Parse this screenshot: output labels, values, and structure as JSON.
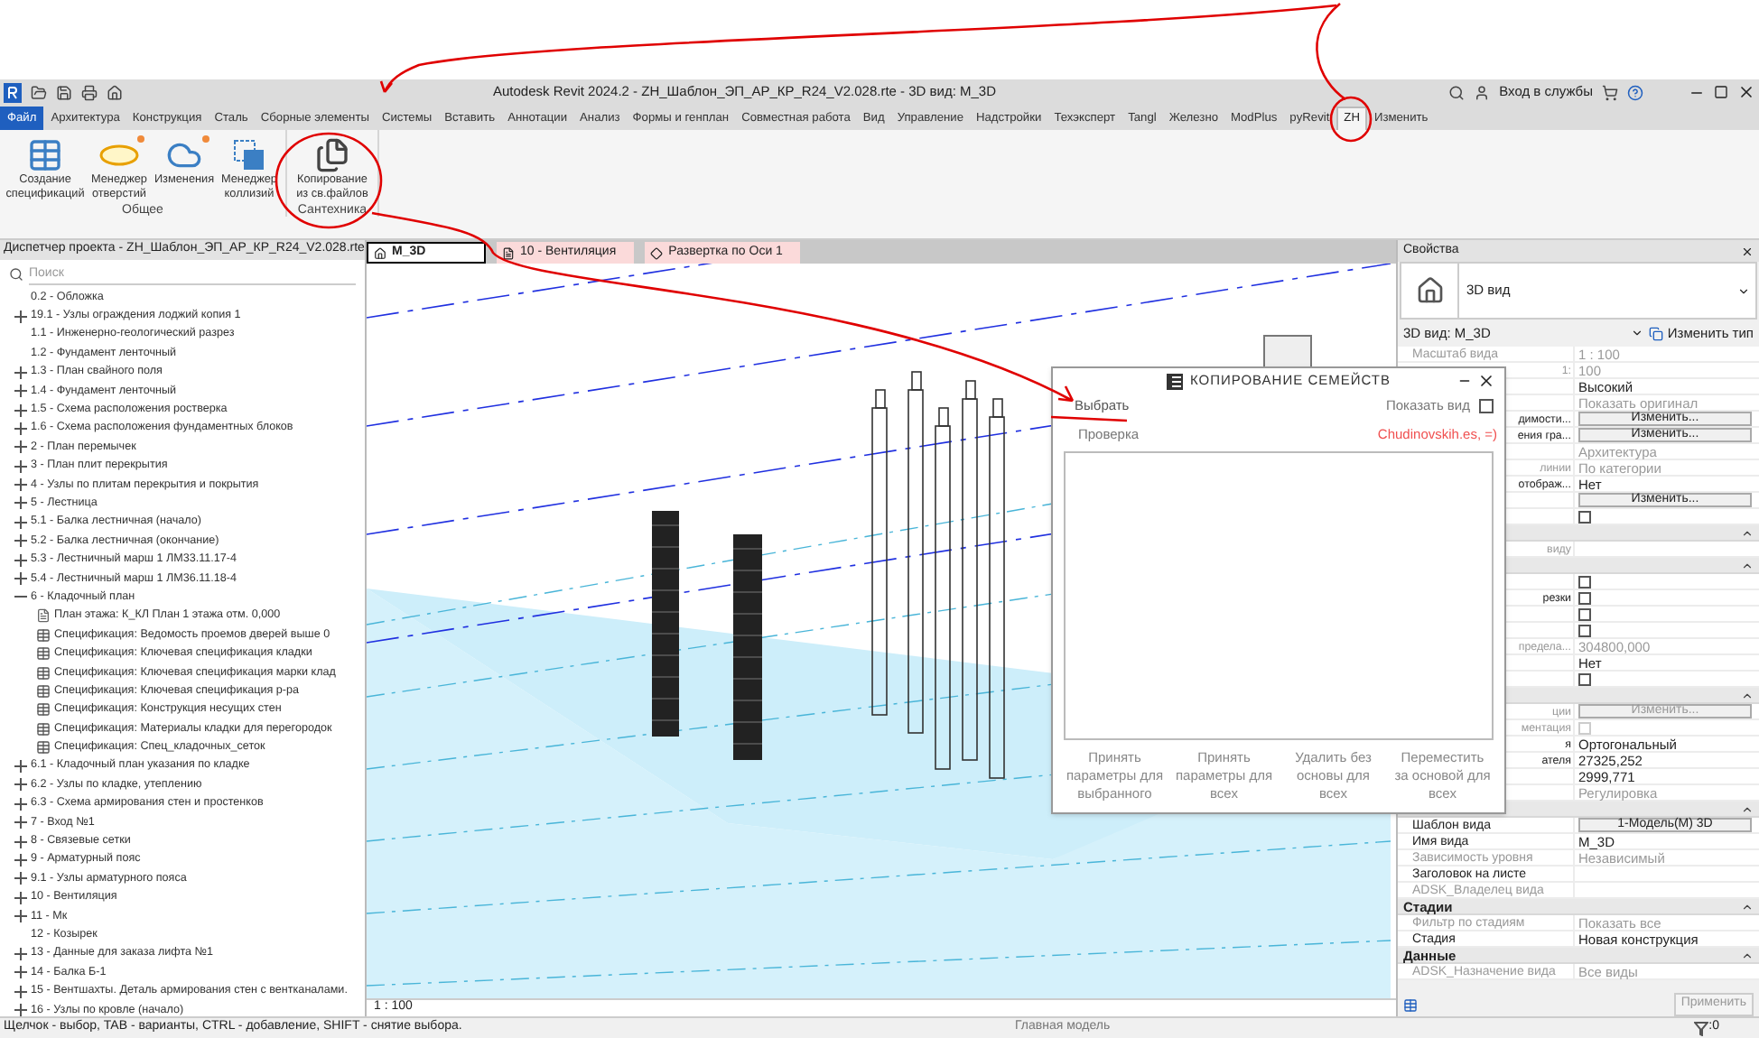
{
  "window": {
    "title": "Autodesk Revit 2024.2 - ZH_Шаблон_ЭП_АР_КР_R24_V2.028.rte - 3D вид: M_3D",
    "sign_in": "Вход в службы"
  },
  "menu_tabs": [
    {
      "label": "Файл",
      "kind": "file",
      "selected": false
    },
    {
      "label": "Архитектура",
      "kind": "tab",
      "selected": false
    },
    {
      "label": "Конструкция",
      "kind": "tab",
      "selected": false
    },
    {
      "label": "Сталь",
      "kind": "tab",
      "selected": false
    },
    {
      "label": "Сборные элементы",
      "kind": "tab",
      "selected": false
    },
    {
      "label": "Системы",
      "kind": "tab",
      "selected": false
    },
    {
      "label": "Вставить",
      "kind": "tab",
      "selected": false
    },
    {
      "label": "Аннотации",
      "kind": "tab",
      "selected": false
    },
    {
      "label": "Анализ",
      "kind": "tab",
      "selected": false
    },
    {
      "label": "Формы и генплан",
      "kind": "tab",
      "selected": false
    },
    {
      "label": "Совместная работа",
      "kind": "tab",
      "selected": false
    },
    {
      "label": "Вид",
      "kind": "tab",
      "selected": false
    },
    {
      "label": "Управление",
      "kind": "tab",
      "selected": false
    },
    {
      "label": "Надстройки",
      "kind": "tab",
      "selected": false
    },
    {
      "label": "Техэксперт",
      "kind": "tab",
      "selected": false
    },
    {
      "label": "Tangl",
      "kind": "tab",
      "selected": false
    },
    {
      "label": "Железно",
      "kind": "tab",
      "selected": false
    },
    {
      "label": "ModPlus",
      "kind": "tab",
      "selected": false
    },
    {
      "label": "pyRevit",
      "kind": "tab",
      "selected": false
    },
    {
      "label": "ZH",
      "kind": "tab",
      "selected": true
    },
    {
      "label": "Изменить",
      "kind": "tab",
      "selected": false
    }
  ],
  "ribbon_groups": [
    {
      "title": "Общее",
      "buttons": [
        {
          "label": "Создание спецификаций",
          "kind": "schedule",
          "new": false
        },
        {
          "label": "Менеджер отверстий",
          "kind": "opening",
          "new": true
        },
        {
          "label": "Изменения",
          "kind": "cloud",
          "new": true
        },
        {
          "label": "Менеджер коллизий",
          "kind": "collision",
          "new": false
        }
      ]
    },
    {
      "title": "Сантехника",
      "buttons": [
        {
          "label": "Копирование из св.файлов",
          "kind": "copy",
          "new": false
        }
      ]
    }
  ],
  "project_browser": {
    "title": "Диспетчер проекта - ZH_Шаблон_ЭП_АР_КР_R24_V2.028.rte",
    "search": {
      "placeholder": "Поиск"
    },
    "items": [
      {
        "label": "0.2 - Обложка"
      },
      {
        "label": "19.1 - Узлы ограждения лоджий копия 1",
        "expanded": false
      },
      {
        "label": "1.1 - Инженерно-геологический разрез"
      },
      {
        "label": "1.2 - Фундамент ленточный"
      },
      {
        "label": "1.3 - План свайного поля",
        "expanded": false
      },
      {
        "label": "1.4 - Фундамент ленточный",
        "expanded": false
      },
      {
        "label": "1.5 - Схема расположения ростверка",
        "expanded": false
      },
      {
        "label": "1.6 - Схема расположения фундаментных блоков",
        "expanded": false
      },
      {
        "label": "2 - План перемычек",
        "expanded": false
      },
      {
        "label": "3 - План плит перекрытия",
        "expanded": false
      },
      {
        "label": "4 - Узлы по плитам перекрытия и покрытия",
        "expanded": false
      },
      {
        "label": "5 - Лестница",
        "expanded": false
      },
      {
        "label": "5.1 - Балка лестничная (начало)",
        "expanded": false
      },
      {
        "label": "5.2 - Балка лестничная (окончание)",
        "expanded": false
      },
      {
        "label": "5.3 - Лестничный марш 1 ЛМ33.11.17-4",
        "expanded": false
      },
      {
        "label": "5.4 - Лестничный марш 1 ЛМ36.11.18-4",
        "expanded": false
      },
      {
        "label": "6 - Кладочный план",
        "expanded": true,
        "children": [
          {
            "label": "План этажа: К_КЛ План 1 этажа отм. 0,000",
            "kind": "plan"
          },
          {
            "label": "Спецификация: Ведомость проемов дверей выше 0",
            "kind": "schedule"
          },
          {
            "label": "Спецификация: Ключевая спецификация кладки",
            "kind": "schedule"
          },
          {
            "label": "Спецификация: Ключевая спецификация марки клад",
            "kind": "schedule"
          },
          {
            "label": "Спецификация: Ключевая спецификация р-ра",
            "kind": "schedule"
          },
          {
            "label": "Спецификация: Конструкция несущих стен",
            "kind": "schedule"
          },
          {
            "label": "Спецификация: Материалы кладки для перегородок",
            "kind": "schedule"
          },
          {
            "label": "Спецификация: Спец_кладочных_сеток",
            "kind": "schedule"
          }
        ]
      },
      {
        "label": "6.1 - Кладочный план указания по кладке",
        "expanded": false
      },
      {
        "label": "6.2 - Узлы по кладке, утеплению",
        "expanded": false
      },
      {
        "label": "6.3 - Схема армирования стен и простенков",
        "expanded": false
      },
      {
        "label": "7 - Вход №1",
        "expanded": false
      },
      {
        "label": "8 - Связевые сетки",
        "expanded": false
      },
      {
        "label": "9 - Арматурный пояс",
        "expanded": false
      },
      {
        "label": "9.1 - Узлы арматурного пояса",
        "expanded": false
      },
      {
        "label": "10 - Вентиляция",
        "expanded": false
      },
      {
        "label": "11 - Мк",
        "expanded": false
      },
      {
        "label": "12 - Козырек"
      },
      {
        "label": "13 - Данные для заказа лифта №1",
        "expanded": false
      },
      {
        "label": "14 - Балка Б-1",
        "expanded": false
      },
      {
        "label": "15 - Вентшахты. Деталь армирования стен с вентканалами.",
        "expanded": false
      },
      {
        "label": "16 - Узлы по кровле (начало)",
        "expanded": false
      }
    ]
  },
  "view_tabs": [
    {
      "label": "M_3D",
      "kind": "model",
      "selected": true
    },
    {
      "label": "10 - Вентиляция",
      "kind": "sheet",
      "selected": false
    },
    {
      "label": "Развертка по Оси 1",
      "kind": "elevation",
      "selected": false
    }
  ],
  "view_scale": "1 : 100",
  "dialog": {
    "title": "КОПИРОВАНИЕ СЕМЕЙСТВ",
    "select_link": "Выбрать",
    "show_view": {
      "label": "Показать вид",
      "checked": false
    },
    "check_label": "Проверка",
    "user": "Chudinovskih.es, =)",
    "buttons": [
      "Принять параметры для выбранного",
      "Принять параметры для всех",
      "Удалить без основы для всех",
      "Переместить за основой для всех"
    ]
  },
  "properties": {
    "title": "Свойства",
    "type_name": "3D вид",
    "selector": "3D вид: M_3D",
    "edit_type": "Изменить тип",
    "rows": [
      {
        "kind": "row",
        "label": "Масштаб вида",
        "value": "1 : 100",
        "disabled": true
      },
      {
        "kind": "row",
        "label": "1:",
        "value": "100",
        "disabled": true
      },
      {
        "kind": "row",
        "value": "Высокий",
        "disabled": false
      },
      {
        "kind": "row",
        "value": "Показать оригинал",
        "disabled": true
      },
      {
        "kind": "button",
        "label": "димости...",
        "value": "Изменить...",
        "disabled": false
      },
      {
        "kind": "button",
        "label": "ения гра...",
        "value": "Изменить...",
        "disabled": false
      },
      {
        "kind": "row",
        "value": "Архитектура",
        "disabled": true
      },
      {
        "kind": "row",
        "label": "линии",
        "value": "По категории",
        "disabled": true
      },
      {
        "kind": "row",
        "label": "отображ...",
        "value": "Нет",
        "disabled": false
      },
      {
        "kind": "button",
        "value": "Изменить...",
        "disabled": false
      },
      {
        "kind": "checkbox",
        "checked": false,
        "disabled": false
      },
      {
        "kind": "group"
      },
      {
        "kind": "row",
        "label": "виду",
        "disabled": true
      },
      {
        "kind": "group"
      },
      {
        "kind": "checkbox",
        "checked": false,
        "disabled": false
      },
      {
        "kind": "checkbox",
        "label": "резки",
        "checked": false,
        "disabled": false
      },
      {
        "kind": "checkbox",
        "checked": false,
        "disabled": false
      },
      {
        "kind": "checkbox",
        "checked": false,
        "disabled": false
      },
      {
        "kind": "row",
        "label": "предела...",
        "value": "304800,000",
        "disabled": true
      },
      {
        "kind": "row",
        "value": "Нет",
        "disabled": false
      },
      {
        "kind": "checkbox",
        "checked": false,
        "disabled": false
      },
      {
        "kind": "group"
      },
      {
        "kind": "button",
        "label": "ции",
        "value": "Изменить...",
        "disabled": true
      },
      {
        "kind": "checkbox",
        "label": "ментация",
        "checked": false,
        "disabled": true
      },
      {
        "kind": "row",
        "label": "я",
        "value": "Ортогональный",
        "disabled": false
      },
      {
        "kind": "row",
        "label": "ателя",
        "value": "27325,252",
        "disabled": false
      },
      {
        "kind": "row",
        "value": "2999,771",
        "disabled": false
      },
      {
        "kind": "row",
        "value": "Регулировка",
        "disabled": true
      },
      {
        "kind": "group"
      },
      {
        "kind": "button",
        "label": "Шаблон вида",
        "value": "1-Модель(М) 3D",
        "disabled": false
      },
      {
        "kind": "row",
        "label": "Имя вида",
        "value": "M_3D",
        "disabled": false
      },
      {
        "kind": "row",
        "label": "Зависимость уровня",
        "value": "Независимый",
        "disabled": true
      },
      {
        "kind": "row",
        "label": "Заголовок на листе",
        "disabled": false
      },
      {
        "kind": "row",
        "label": "ADSK_Владелец вида",
        "disabled": true
      },
      {
        "kind": "group",
        "label": "Стадии"
      },
      {
        "kind": "row",
        "label": "Фильтр по стадиям",
        "value": "Показать все",
        "disabled": true
      },
      {
        "kind": "row",
        "label": "Стадия",
        "value": "Новая конструкция",
        "disabled": false
      },
      {
        "kind": "group",
        "label": "Данные"
      },
      {
        "kind": "row",
        "label": "ADSK_Назначение вида",
        "value": "Все виды",
        "disabled": true
      }
    ],
    "apply": "Применить"
  },
  "status_bar": {
    "hint": "Щелчок - выбор, TAB - варианты, CTRL - добавление, SHIFT - снятие выбора.",
    "model": "Главная модель",
    "filter_count": ":0"
  }
}
